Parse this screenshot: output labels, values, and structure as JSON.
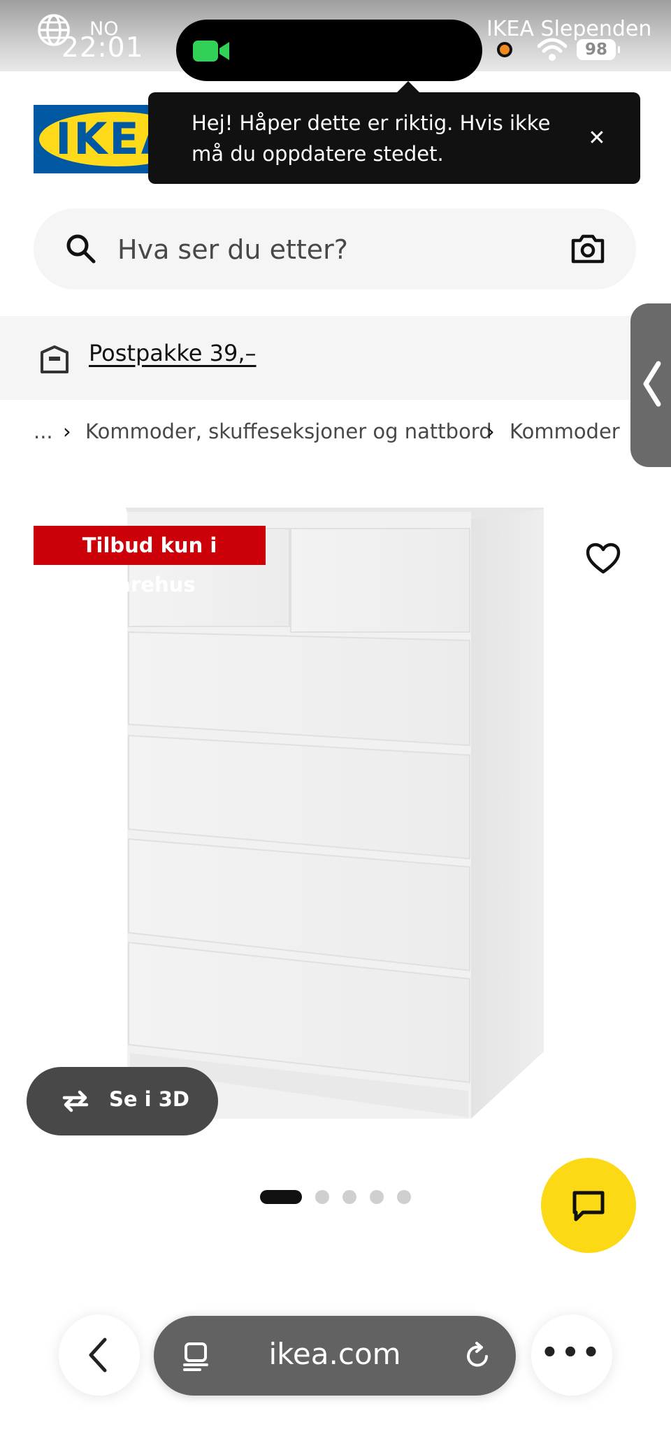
{
  "status_bar": {
    "language": "NO",
    "time": "22:01",
    "carrier": "IKEA Slependen",
    "battery": "98"
  },
  "header": {
    "logo_text": "IKEA",
    "toast": {
      "message": "Hej! Håper dette er riktig. Hvis ikke må du oppdatere stedet.",
      "close_label": "✕"
    }
  },
  "search": {
    "placeholder": "Hva ser du etter?"
  },
  "shipping": {
    "label": "Postpakke 39,–"
  },
  "breadcrumb": {
    "items": [
      "...",
      "Kommoder, skuffeseksjoner og nattbord",
      "Kommoder"
    ],
    "separator": "›"
  },
  "product": {
    "badge": "Tilbud kun i varehus",
    "view_3d_label": "Se i 3D",
    "image_count": 5,
    "active_image": 1
  },
  "browser": {
    "url": "ikea.com"
  },
  "colors": {
    "ikea_blue": "#0058a3",
    "ikea_yellow": "#ffda1a",
    "offer_red": "#cc0008",
    "chat_yellow": "#fbd914"
  }
}
